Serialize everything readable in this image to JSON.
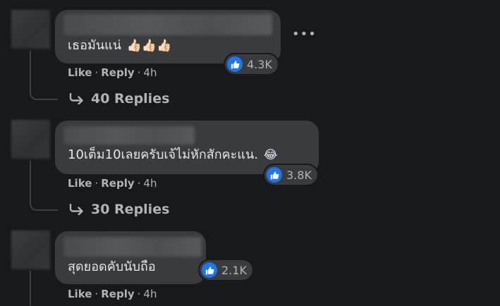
{
  "comments": [
    {
      "text": "เธอมันแน่",
      "emoji": "👍🏻👍🏻👍🏻",
      "reaction_count": "4.3K",
      "like_label": "Like",
      "reply_label": "Reply",
      "time": "4h",
      "replies_label": "40 Replies"
    },
    {
      "text": "10เต็ม10เลยครับเจ้ไม่หักสักคะแน.",
      "emoji": "😂",
      "reaction_count": "3.8K",
      "like_label": "Like",
      "reply_label": "Reply",
      "time": "4h",
      "replies_label": "30 Replies"
    },
    {
      "text": "สุดยอดคับนับถือ",
      "reaction_count": "2.1K",
      "like_label": "Like",
      "reply_label": "Reply",
      "time": "4h"
    }
  ],
  "more_icon": "more-horizontal-icon",
  "colors": {
    "background": "#18191a",
    "bubble": "#3a3b3c",
    "like_blue": "#1877f2",
    "secondary_text": "#b0b3b8"
  }
}
